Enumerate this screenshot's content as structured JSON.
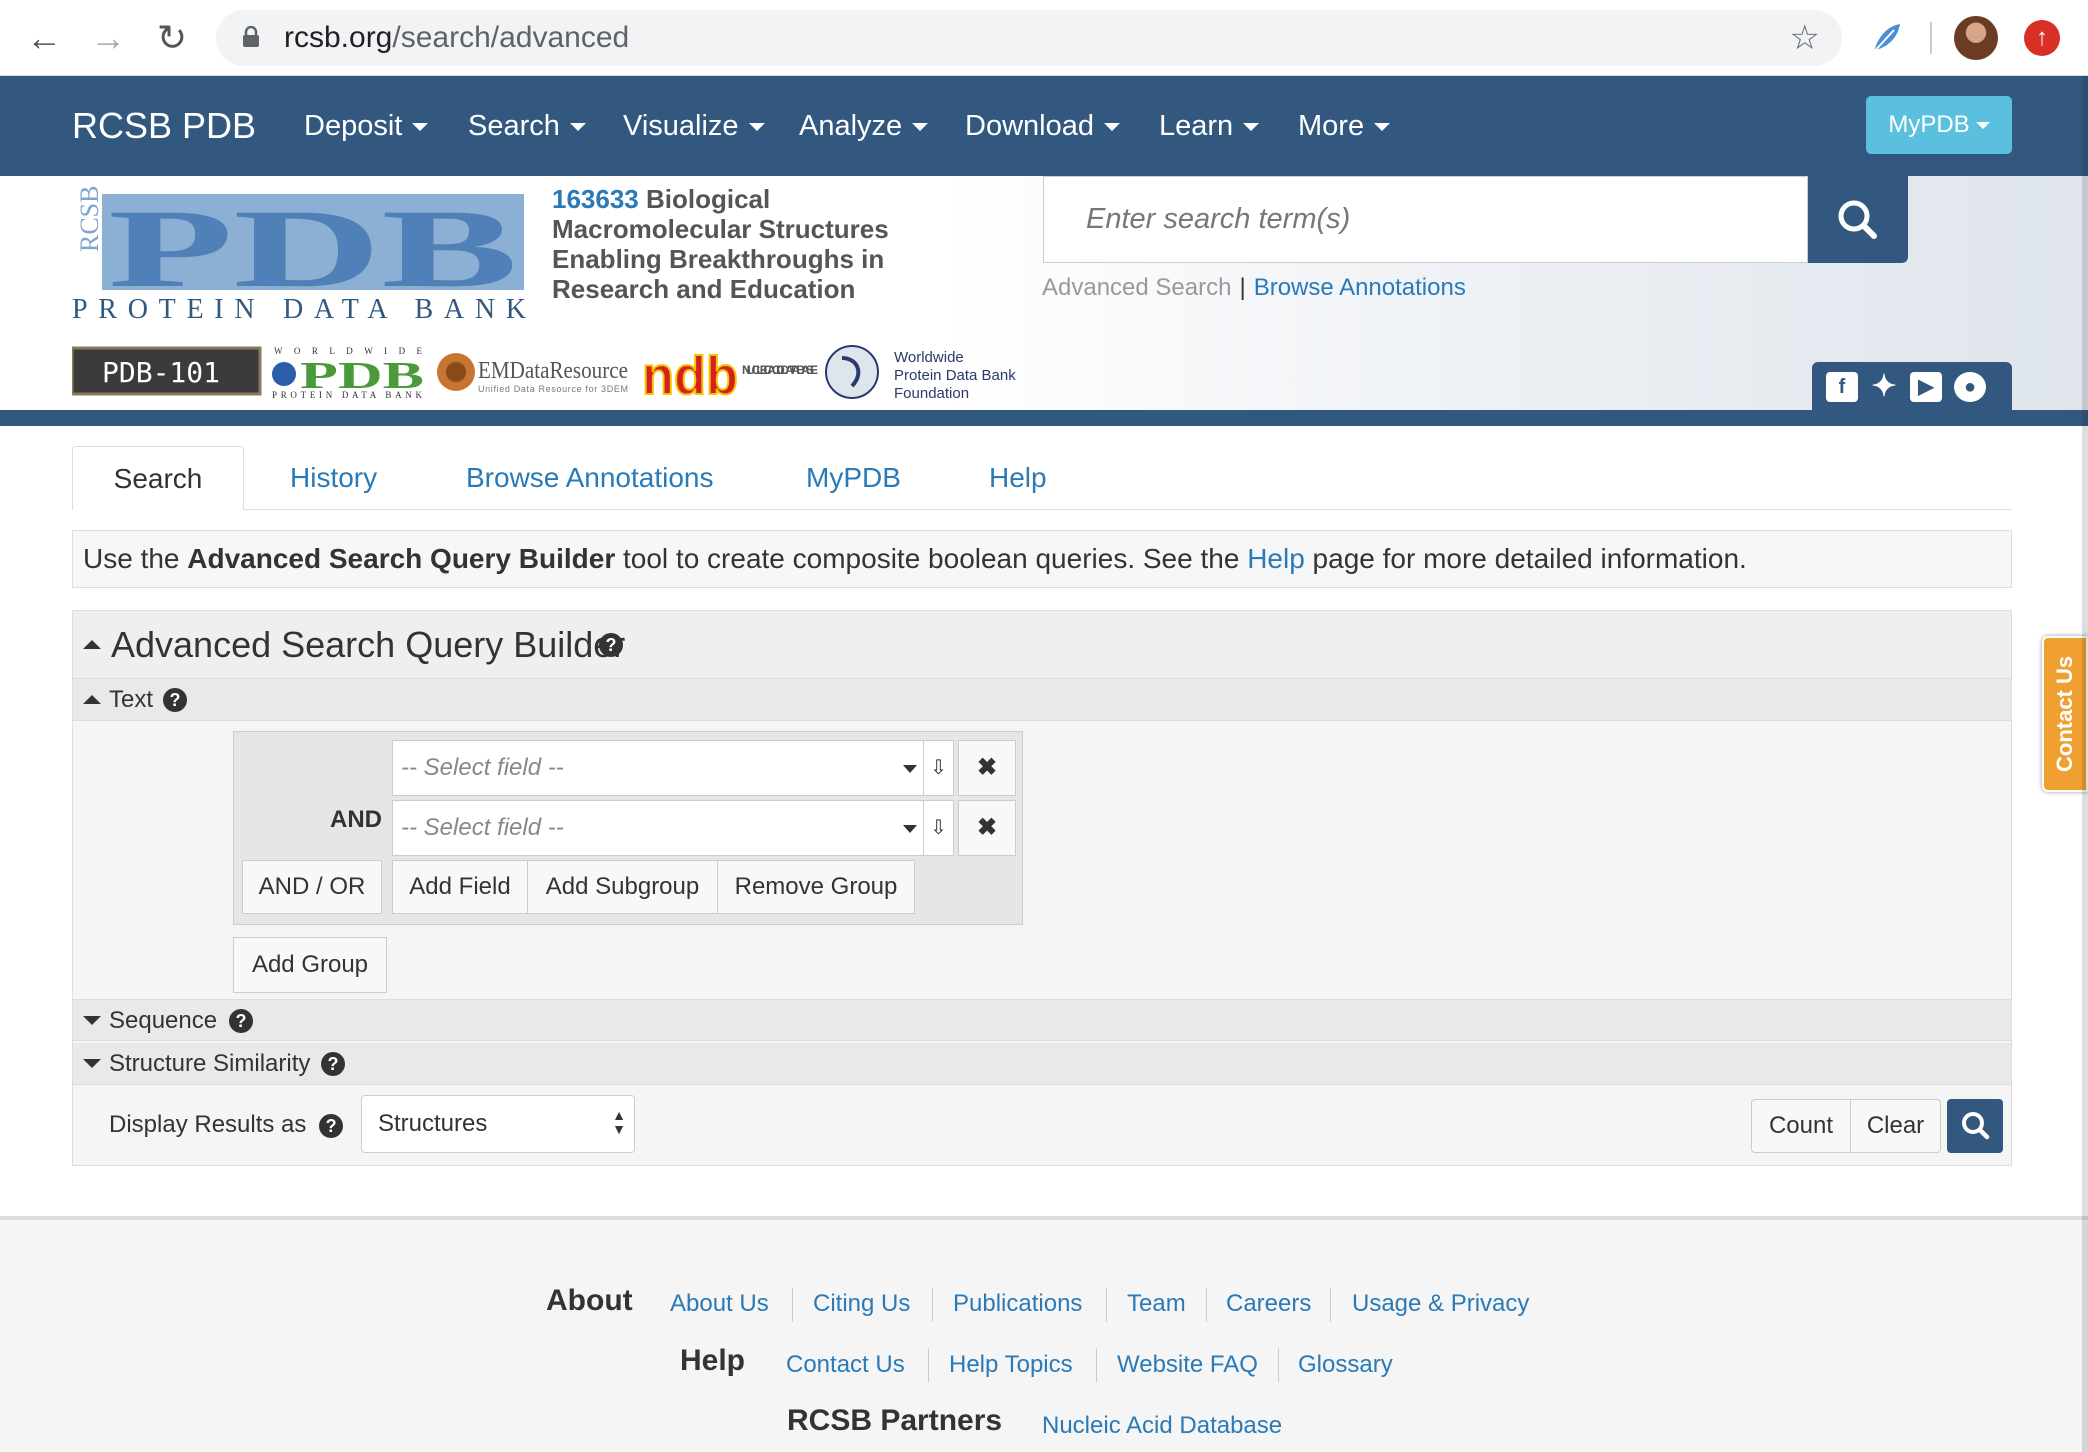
{
  "browser": {
    "url_host": "rcsb.org",
    "url_path": "/search/advanced"
  },
  "topnav": {
    "brand": "RCSB PDB",
    "menu": [
      "Deposit",
      "Search",
      "Visualize",
      "Analyze",
      "Download",
      "Learn",
      "More"
    ],
    "mypdb": "MyPDB"
  },
  "header": {
    "logo_text": "PDB",
    "logo_sub": "PROTEIN DATA BANK",
    "logo_side": "RCSB",
    "structure_count": "163633",
    "tagline": "Biological Macromolecular Structures Enabling Breakthroughs in Research and Education",
    "search_placeholder": "Enter search term(s)",
    "advanced_search": "Advanced Search",
    "browse_annotations": "Browse Annotations",
    "partners": {
      "pdb101": "PDB-101",
      "wwpdb_top": "WORLDWIDE",
      "wwpdb": "PDB",
      "wwpdb_sub": "PROTEIN DATA BANK",
      "emdr": "EMDataResource",
      "emdr_sub": "Unified Data Resource for 3DEM",
      "ndb": "ndb",
      "ndb_sub": "NUCLEIC ACID DATABASE",
      "foundation_1": "Worldwide",
      "foundation_2": "Protein Data Bank",
      "foundation_3": "Foundation"
    }
  },
  "tabs": [
    "Search",
    "History",
    "Browse Annotations",
    "MyPDB",
    "Help"
  ],
  "info": {
    "pre": "Use the ",
    "bold": "Advanced Search Query Builder",
    "mid": " tool to create composite boolean queries. See the ",
    "link": "Help",
    "post": " page for more detailed information."
  },
  "builder": {
    "title": "Advanced Search Query Builder",
    "text_section": "Text",
    "select_placeholder": "-- Select field --",
    "and_label": "AND",
    "buttons": {
      "and_or": "AND / OR",
      "add_field": "Add Field",
      "add_subgroup": "Add Subgroup",
      "remove_group": "Remove Group",
      "add_group": "Add Group"
    },
    "sequence_section": "Sequence",
    "structure_section": "Structure Similarity",
    "display_label": "Display Results as",
    "display_value": "Structures",
    "count": "Count",
    "clear": "Clear"
  },
  "contact_tab": "Contact Us",
  "footer": {
    "about": "About",
    "about_links": [
      "About Us",
      "Citing Us",
      "Publications",
      "Team",
      "Careers",
      "Usage & Privacy"
    ],
    "help": "Help",
    "help_links": [
      "Contact Us",
      "Help Topics",
      "Website FAQ",
      "Glossary"
    ],
    "partners": "RCSB Partners",
    "partner_links": [
      "Nucleic Acid Database"
    ]
  },
  "colors": {
    "nav_blue": "#325880",
    "link_blue": "#2a7ab8",
    "mypdb_button": "#5bc0de",
    "contact_orange": "#f0a030"
  }
}
